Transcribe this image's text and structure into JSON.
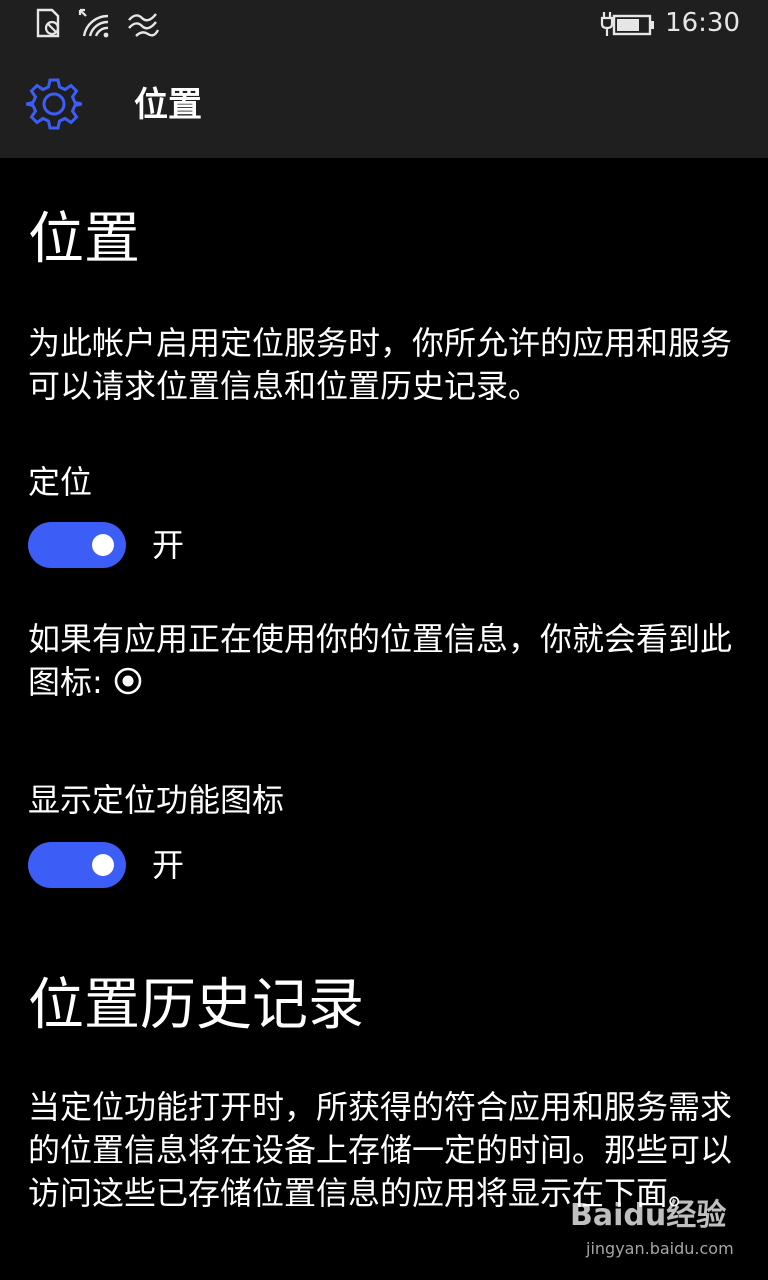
{
  "status_bar": {
    "time": "16:30",
    "icons": [
      "sim-off-icon",
      "wifi-icon",
      "data-sense-icon",
      "battery-charging-icon"
    ]
  },
  "header": {
    "icon": "gear-icon",
    "title": "位置"
  },
  "location_section": {
    "heading": "位置",
    "description": "为此帐户启用定位服务时，你所允许的应用和服务可以请求位置信息和位置历史记录。",
    "location_toggle": {
      "label": "定位",
      "state": "开",
      "on": true
    },
    "icon_info": "如果有应用正在使用你的位置信息，你就会看到此图标:",
    "icon_info_glyph": "location-in-use-icon",
    "show_icon_toggle": {
      "label": "显示定位功能图标",
      "state": "开",
      "on": true
    }
  },
  "history_section": {
    "heading": "位置历史记录",
    "description": "当定位功能打开时，所获得的符合应用和服务需求的位置信息将在设备上存储一定的时间。那些可以访问这些已存储位置信息的应用将显示在下面。"
  },
  "watermark": {
    "logo": "Baidu经验",
    "url": "jingyan.baidu.com"
  },
  "colors": {
    "accent": "#3c5ef7",
    "background": "#000000",
    "bar": "#1f1f1f",
    "text": "#ffffff"
  }
}
